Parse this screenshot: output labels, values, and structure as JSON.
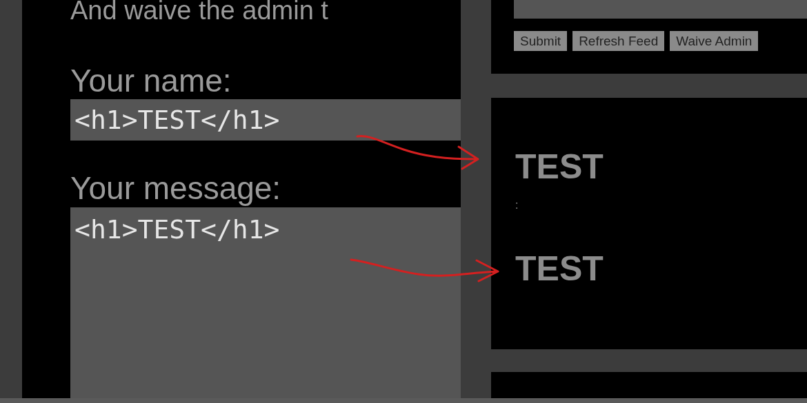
{
  "form": {
    "intro": "And waive the admin t",
    "name_label": "Your name:",
    "name_value": "<h1>TEST</h1>",
    "message_label": "Your message:",
    "message_value": "<h1>TEST</h1>"
  },
  "controls": {
    "buttons": [
      "Submit",
      "Refresh Feed",
      "Waive Admin"
    ]
  },
  "feed": {
    "posts": [
      {
        "name": "TEST",
        "separator": ":",
        "message": "TEST"
      }
    ]
  }
}
